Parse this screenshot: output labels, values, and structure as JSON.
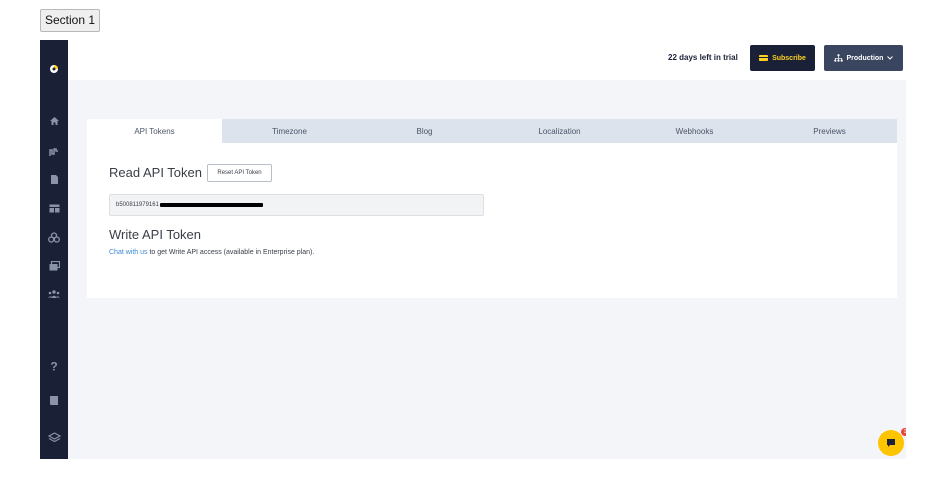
{
  "section_button": {
    "label": "Section 1"
  },
  "header": {
    "trial_text": "22 days left in trial",
    "subscribe_label": "Subscribe",
    "environment_label": "Production",
    "accent_yellow": "#ffd21f",
    "navy": "#1a2137"
  },
  "sidebar": {
    "items": [
      {
        "icon": "logo-icon"
      },
      {
        "icon": "home-icon"
      },
      {
        "icon": "content-icon"
      },
      {
        "icon": "document-icon"
      },
      {
        "icon": "table-icon"
      },
      {
        "icon": "assets-icon"
      },
      {
        "icon": "media-icon"
      },
      {
        "icon": "team-icon"
      },
      {
        "icon": "help-icon"
      },
      {
        "icon": "book-icon"
      },
      {
        "icon": "layers-icon"
      }
    ]
  },
  "tabs": [
    {
      "label": "API Tokens",
      "active": true
    },
    {
      "label": "Timezone",
      "active": false
    },
    {
      "label": "Blog",
      "active": false
    },
    {
      "label": "Localization",
      "active": false
    },
    {
      "label": "Webhooks",
      "active": false
    },
    {
      "label": "Previews",
      "active": false
    }
  ],
  "read_token": {
    "title": "Read API Token",
    "reset_label": "Reset API Token",
    "token_visible": "b500811979161"
  },
  "write_token": {
    "title": "Write API Token",
    "link_text": "Chat with us",
    "desc_text": " to get Write API access (available in Enterprise plan)."
  },
  "chat": {
    "badge": "1"
  }
}
